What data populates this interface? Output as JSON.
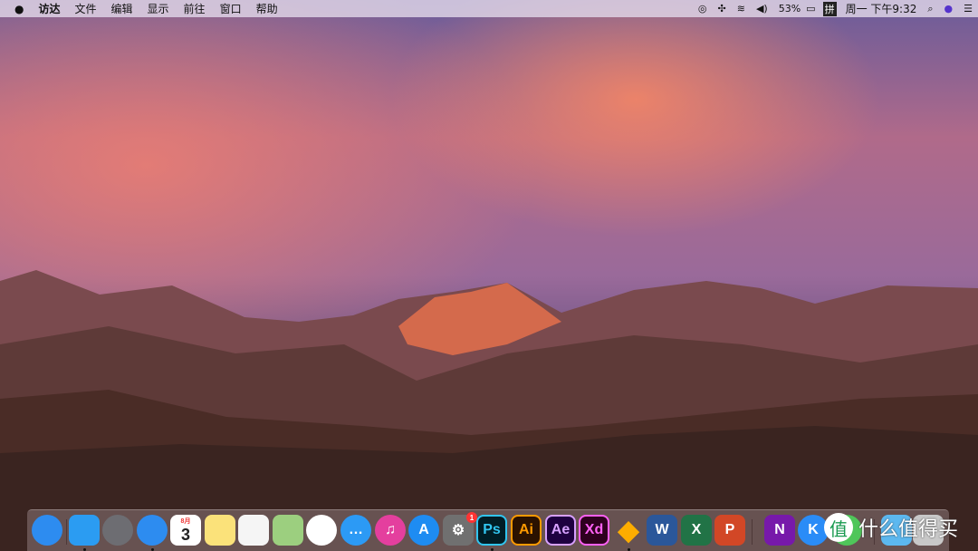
{
  "menubar": {
    "apple": "",
    "items": [
      "访达",
      "文件",
      "编辑",
      "显示",
      "前往",
      "窗口",
      "帮助"
    ],
    "status": {
      "battery": "53%",
      "input_method": "拼",
      "clock": "周一 下午9:32"
    }
  },
  "dock": {
    "apps": [
      {
        "name": "safari-downloads",
        "label": "",
        "color": "#2d8cf0"
      },
      {
        "name": "finder",
        "label": "",
        "color": "#2b9cf2",
        "running": true
      },
      {
        "name": "launchpad",
        "label": "",
        "color": "#6d6d72"
      },
      {
        "name": "safari",
        "label": "",
        "color": "#2d8cf0",
        "running": true
      },
      {
        "name": "calendar",
        "label": "3",
        "month": "8月",
        "color": "#ffffff"
      },
      {
        "name": "notes",
        "label": "",
        "color": "#fbe27a"
      },
      {
        "name": "reminders",
        "label": "",
        "color": "#f5f5f5"
      },
      {
        "name": "maps",
        "label": "",
        "color": "#9ccf7f"
      },
      {
        "name": "photos",
        "label": "",
        "color": "#ffffff"
      },
      {
        "name": "messages",
        "label": "…",
        "color": "#2c9af5"
      },
      {
        "name": "itunes",
        "label": "♫",
        "color": "#e43f9e"
      },
      {
        "name": "app-store",
        "label": "A",
        "color": "#1e8cf2"
      },
      {
        "name": "system-preferences",
        "label": "⚙",
        "color": "#707070",
        "badge": "1"
      },
      {
        "name": "photoshop",
        "label": "Ps",
        "color": "#001d26",
        "fg": "#31c5f0",
        "running": true
      },
      {
        "name": "illustrator",
        "label": "Ai",
        "color": "#2b1200",
        "fg": "#ff9a00"
      },
      {
        "name": "after-effects",
        "label": "Ae",
        "color": "#1f0040",
        "fg": "#d8a1ff"
      },
      {
        "name": "xd",
        "label": "Xd",
        "color": "#2e001f",
        "fg": "#ff61f6"
      },
      {
        "name": "sketch",
        "label": "◆",
        "color": "transparent",
        "fg": "#fdad00",
        "running": true
      },
      {
        "name": "word",
        "label": "W",
        "color": "#2b579a"
      },
      {
        "name": "excel",
        "label": "X",
        "color": "#217346"
      },
      {
        "name": "powerpoint",
        "label": "P",
        "color": "#d24726"
      },
      {
        "name": "onenote",
        "label": "N",
        "color": "#7719aa"
      },
      {
        "name": "kuaibo",
        "label": "K",
        "color": "#2a8cf7"
      },
      {
        "name": "wechat",
        "label": "",
        "color": "#4fc65a"
      },
      {
        "name": "folder",
        "label": "",
        "color": "#5cb8ef"
      },
      {
        "name": "trash",
        "label": "",
        "color": "#c8c8c8"
      }
    ]
  },
  "watermark": {
    "logo": "值",
    "text": "什么值得买"
  }
}
